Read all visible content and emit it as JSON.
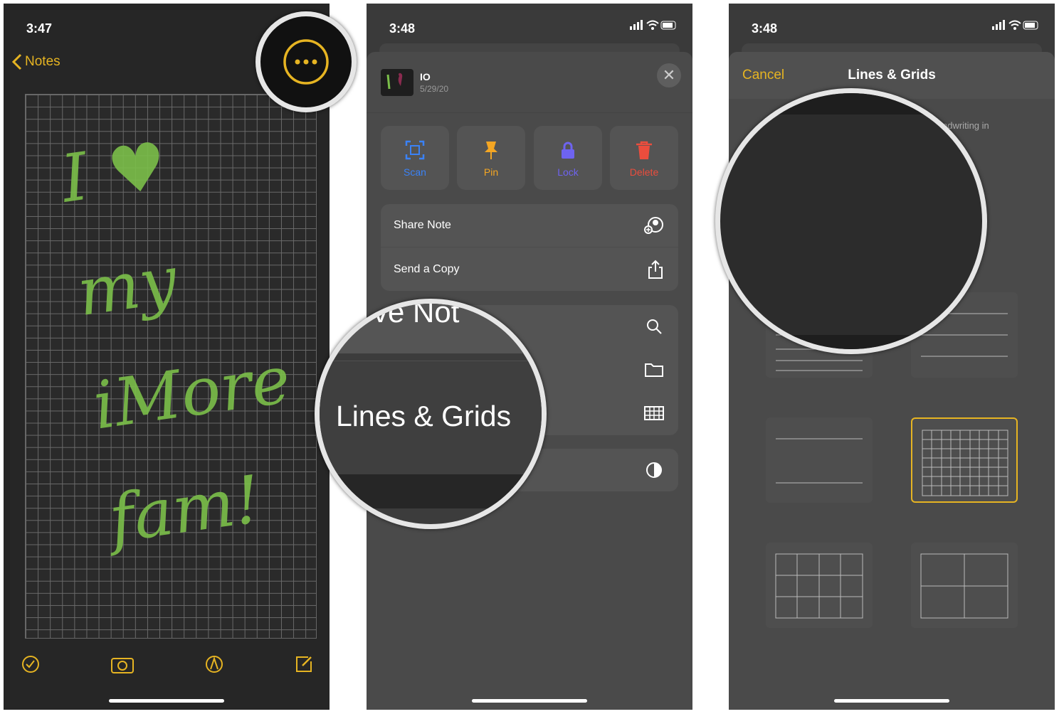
{
  "panel1": {
    "time": "3:47",
    "back_label": "Notes",
    "handwriting": "I ♥ my iMore fam!",
    "toolbar": [
      "checklist-icon",
      "camera-icon",
      "markup-icon",
      "compose-icon"
    ],
    "accent": "#e6b422"
  },
  "panel2": {
    "time": "3:48",
    "note": {
      "title": "IO",
      "date": "5/29/20"
    },
    "actions": [
      {
        "label": "Scan",
        "color": "#3a82f7"
      },
      {
        "label": "Pin",
        "color": "#f4a623"
      },
      {
        "label": "Lock",
        "color": "#6e63f0"
      },
      {
        "label": "Delete",
        "color": "#eb4d3d"
      }
    ],
    "rows": [
      {
        "label": "Share Note",
        "icon": "share-person-icon"
      },
      {
        "label": "Send a Copy",
        "icon": "share-icon"
      }
    ],
    "partial_text": "ve Not",
    "magnified_label": "Lines & Grids"
  },
  "panel3": {
    "time": "3:48",
    "cancel": "Cancel",
    "title": "Lines & Grids",
    "partial_desc": "ndwriting in",
    "selected": "small-grid"
  }
}
